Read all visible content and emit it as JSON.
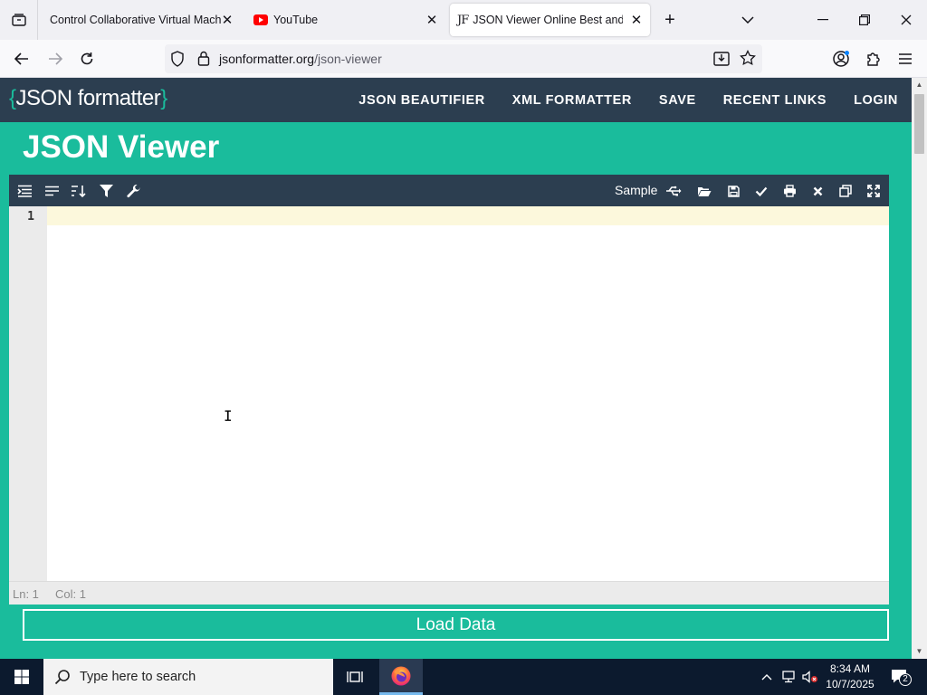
{
  "browser": {
    "tabs": [
      {
        "title": "Control Collaborative Virtual Machine"
      },
      {
        "title": "YouTube"
      },
      {
        "title": "JSON Viewer Online Best and Free"
      }
    ],
    "url": {
      "domain": "jsonformatter.org",
      "path": "/json-viewer"
    }
  },
  "site": {
    "logo": {
      "open": "{",
      "text": "JSON formatter",
      "close": "}"
    },
    "nav": [
      "JSON BEAUTIFIER",
      "XML FORMATTER",
      "SAVE",
      "RECENT LINKS",
      "LOGIN"
    ],
    "page_title": "JSON Viewer",
    "editor": {
      "sample_label": "Sample",
      "line_number": "1",
      "status_line": "Ln: 1",
      "status_col": "Col: 1"
    },
    "load_button": "Load Data"
  },
  "taskbar": {
    "search_placeholder": "Type here to search",
    "time": "8:34 AM",
    "date": "10/7/2025",
    "notification_count": "2"
  },
  "colors": {
    "brand_teal": "#1abc9c",
    "header_dark": "#2c3e50",
    "active_line": "#fcf8dc"
  }
}
